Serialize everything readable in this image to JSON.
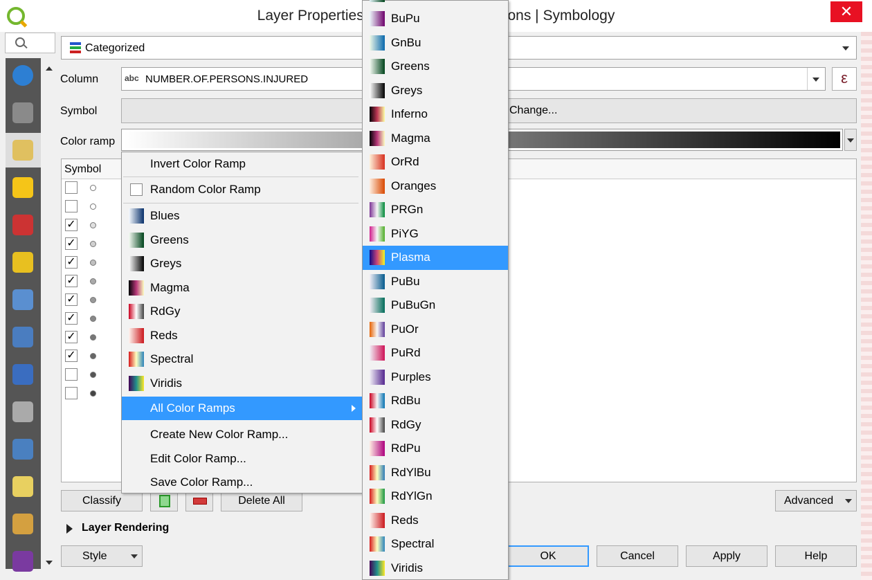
{
  "window": {
    "title": "Layer Properties - Motor Vehicle Collisions | Symbology",
    "close_glyph": "✕"
  },
  "renderer": {
    "selected": "Categorized"
  },
  "column": {
    "label": "Column",
    "type_badge": "abc",
    "value": "NUMBER.OF.PERSONS.INJURED",
    "expr_glyph": "ε"
  },
  "symbol": {
    "label": "Symbol",
    "button_text": "Change..."
  },
  "color_ramp": {
    "label": "Color ramp"
  },
  "table": {
    "col_symbol": "Symbol"
  },
  "rows": [
    {
      "checked": false,
      "dot": "#ffffff"
    },
    {
      "checked": false,
      "dot": "#ffffff"
    },
    {
      "checked": true,
      "dot": "#e0e0e0"
    },
    {
      "checked": true,
      "dot": "#d0d0d0"
    },
    {
      "checked": true,
      "dot": "#c0c0c0"
    },
    {
      "checked": true,
      "dot": "#aaaaaa"
    },
    {
      "checked": true,
      "dot": "#999999"
    },
    {
      "checked": true,
      "dot": "#888888"
    },
    {
      "checked": true,
      "dot": "#777777"
    },
    {
      "checked": true,
      "dot": "#666666"
    },
    {
      "checked": false,
      "dot": "#555555"
    },
    {
      "checked": false,
      "dot": "#444444"
    }
  ],
  "context_menu": {
    "invert": "Invert Color Ramp",
    "random": "Random Color Ramp",
    "ramps": [
      {
        "label": "Blues",
        "c1": "#f7fbff",
        "c2": "#08306b"
      },
      {
        "label": "Greens",
        "c1": "#f7fcf5",
        "c2": "#00441b"
      },
      {
        "label": "Greys",
        "c1": "#ffffff",
        "c2": "#000000"
      },
      {
        "label": "Magma",
        "c1": "#000004",
        "c2": "#fcfdbf",
        "mid": "#b73779"
      },
      {
        "label": "RdGy",
        "c1": "#ca0020",
        "c2": "#404040",
        "mid": "#ffffff"
      },
      {
        "label": "Reds",
        "c1": "#fff5f0",
        "c2": "#cb181d"
      },
      {
        "label": "Spectral",
        "c1": "#d7191c",
        "c2": "#2b83ba",
        "mid": "#ffffbf"
      },
      {
        "label": "Viridis",
        "c1": "#440154",
        "c2": "#fde725",
        "mid": "#21918c"
      }
    ],
    "all": "All Color Ramps",
    "create": "Create New Color Ramp...",
    "edit": "Edit Color Ramp...",
    "save": "Save Color Ramp..."
  },
  "submenu": [
    {
      "label": "BuPu",
      "c1": "#edf8fb",
      "c2": "#6e016b"
    },
    {
      "label": "GnBu",
      "c1": "#f0f9e8",
      "c2": "#0868ac"
    },
    {
      "label": "Greens",
      "c1": "#f7fcf5",
      "c2": "#00441b"
    },
    {
      "label": "Greys",
      "c1": "#ffffff",
      "c2": "#000000"
    },
    {
      "label": "Inferno",
      "c1": "#000004",
      "c2": "#fcffa4",
      "mid": "#bc3754"
    },
    {
      "label": "Magma",
      "c1": "#000004",
      "c2": "#fcfdbf",
      "mid": "#b73779"
    },
    {
      "label": "OrRd",
      "c1": "#fef0d9",
      "c2": "#d7301f"
    },
    {
      "label": "Oranges",
      "c1": "#feedde",
      "c2": "#d94801"
    },
    {
      "label": "PRGn",
      "c1": "#7b3294",
      "c2": "#008837",
      "mid": "#f7f7f7"
    },
    {
      "label": "PiYG",
      "c1": "#d01c8b",
      "c2": "#4dac26",
      "mid": "#f7f7f7"
    },
    {
      "label": "Plasma",
      "c1": "#0d0887",
      "c2": "#f0f921",
      "mid": "#cc4778"
    },
    {
      "label": "PuBu",
      "c1": "#f1eef6",
      "c2": "#045a8d"
    },
    {
      "label": "PuBuGn",
      "c1": "#f6eff7",
      "c2": "#016c59"
    },
    {
      "label": "PuOr",
      "c1": "#e66101",
      "c2": "#5e3c99",
      "mid": "#f7f7f7"
    },
    {
      "label": "PuRd",
      "c1": "#f1eef6",
      "c2": "#ce1256"
    },
    {
      "label": "Purples",
      "c1": "#f2f0f7",
      "c2": "#54278f"
    },
    {
      "label": "RdBu",
      "c1": "#ca0020",
      "c2": "#0571b0",
      "mid": "#f7f7f7"
    },
    {
      "label": "RdGy",
      "c1": "#ca0020",
      "c2": "#404040",
      "mid": "#ffffff"
    },
    {
      "label": "RdPu",
      "c1": "#feebe2",
      "c2": "#ae017e"
    },
    {
      "label": "RdYlBu",
      "c1": "#d7191c",
      "c2": "#2c7bb6",
      "mid": "#ffffbf"
    },
    {
      "label": "RdYlGn",
      "c1": "#d7191c",
      "c2": "#1a9641",
      "mid": "#ffffbf"
    },
    {
      "label": "Reds",
      "c1": "#fff5f0",
      "c2": "#cb181d"
    },
    {
      "label": "Spectral",
      "c1": "#d7191c",
      "c2": "#2b83ba",
      "mid": "#ffffbf"
    },
    {
      "label": "Viridis",
      "c1": "#440154",
      "c2": "#fde725",
      "mid": "#21918c"
    }
  ],
  "submenu_highlight": "Plasma",
  "buttons": {
    "classify": "Classify",
    "delete_all": "Delete All",
    "advanced": "Advanced",
    "layer_rendering": "Layer Rendering",
    "style": "Style",
    "ok": "OK",
    "cancel": "Cancel",
    "apply": "Apply",
    "help": "Help"
  },
  "sidebar_icons": [
    "information-icon",
    "source-icon",
    "symbology-icon",
    "labels-icon",
    "diagrams-icon",
    "3d-view-icon",
    "fields-icon",
    "attributes-form-icon",
    "joins-icon",
    "auxiliary-storage-icon",
    "actions-icon",
    "display-icon",
    "rendering-icon",
    "variables-icon"
  ],
  "colors": {
    "accent": "#3399ff",
    "close": "#e81123"
  }
}
